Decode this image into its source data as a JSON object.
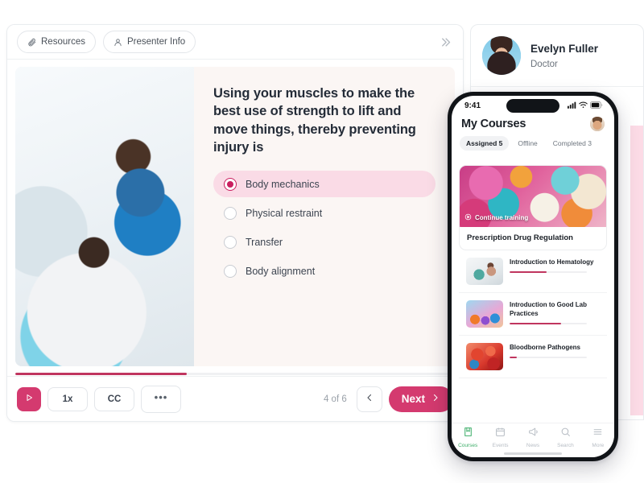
{
  "player": {
    "chips": [
      {
        "label": "Resources",
        "icon": "paperclip-icon"
      },
      {
        "label": "Presenter Info",
        "icon": "person-icon"
      }
    ],
    "collapse_icon": "chevron-double-right-icon",
    "question": "Using your muscles to make the best use of strength to lift and move things, thereby preventing injury is",
    "options": [
      {
        "label": "Body mechanics",
        "selected": true
      },
      {
        "label": "Physical restraint",
        "selected": false
      },
      {
        "label": "Transfer",
        "selected": false
      },
      {
        "label": "Body alignment",
        "selected": false
      }
    ],
    "progress_percent": 39,
    "toolbar": {
      "play_label": "play-icon",
      "speed_label": "1x",
      "captions_label": "CC",
      "more_label": "•••",
      "counter": "4 of 6",
      "prev_label": "‹",
      "next_label": "Next"
    },
    "slide_image_alt": "physical-therapist-assisting-patient-with-dumbbells"
  },
  "side_panel": {
    "user": {
      "name": "Evelyn Fuller",
      "role": "Doctor",
      "avatar_alt": "evelyn-fuller-portrait"
    }
  },
  "phone": {
    "status": {
      "time": "9:41",
      "cellular_icon": "signal-bars-icon",
      "wifi_icon": "wifi-icon",
      "battery_icon": "battery-icon"
    },
    "header": {
      "title": "My Courses",
      "avatar_alt": "account-avatar"
    },
    "tabs": [
      {
        "label": "Assigned 5",
        "active": true
      },
      {
        "label": "Offline",
        "active": false
      },
      {
        "label": "Completed 3",
        "active": false
      }
    ],
    "featured": {
      "badge": "Continue training",
      "badge_icon": "play-circle-icon",
      "title": "Prescription Drug Regulation",
      "image_alt": "colorful-pills-and-capsules"
    },
    "courses": [
      {
        "title": "Introduction to Hematology",
        "progress_percent": 48,
        "image_alt": "clinician-with-patient"
      },
      {
        "title": "Introduction to Good Lab Practices",
        "progress_percent": 66,
        "image_alt": "colorful-lab-abstract"
      },
      {
        "title": "Bloodborne Pathogens",
        "progress_percent": 9,
        "image_alt": "red-blood-cells"
      }
    ],
    "tabbar": [
      {
        "label": "Courses",
        "icon": "book-icon",
        "active": true
      },
      {
        "label": "Events",
        "icon": "calendar-icon",
        "active": false
      },
      {
        "label": "News",
        "icon": "megaphone-icon",
        "active": false
      },
      {
        "label": "Search",
        "icon": "search-icon",
        "active": false
      },
      {
        "label": "More",
        "icon": "menu-icon",
        "active": false
      }
    ]
  },
  "colors": {
    "accent": "#d43a6f",
    "accent_dark": "#c0355f",
    "selected_option_bg": "#fadbe6",
    "nav_active": "#3fae6a",
    "side_pink": "#fcdbe6"
  }
}
